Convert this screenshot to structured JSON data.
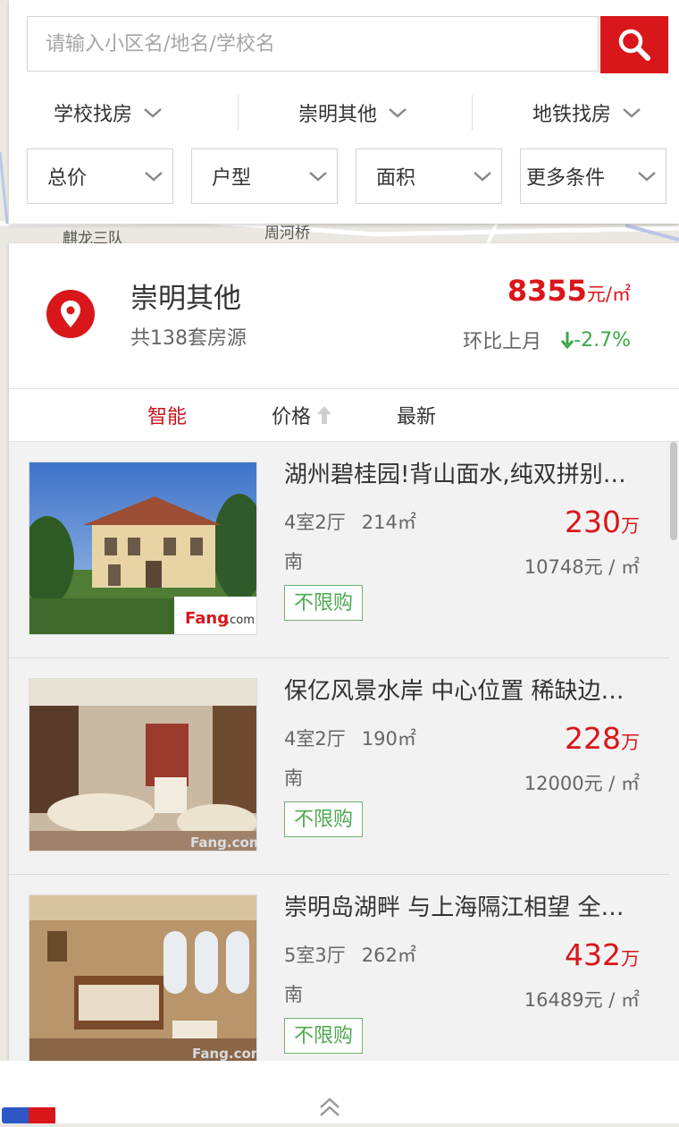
{
  "map": {
    "labels": [
      "麒龙三队",
      "周河桥"
    ]
  },
  "search": {
    "placeholder": "请输入小区名/地名/学校名"
  },
  "quick_filters": [
    {
      "label": "学校找房"
    },
    {
      "label": "崇明其他"
    },
    {
      "label": "地铁找房"
    }
  ],
  "conditions": [
    {
      "label": "总价"
    },
    {
      "label": "户型"
    },
    {
      "label": "面积"
    },
    {
      "label": "更多条件"
    }
  ],
  "area": {
    "name": "崇明其他",
    "count_text": "共138套房源",
    "price": "8355",
    "price_unit": "元/㎡",
    "change_label": "环比上月",
    "change_pct": "-2.7%"
  },
  "sort": {
    "smart": "智能",
    "price": "价格",
    "latest": "最新"
  },
  "listings": [
    {
      "title": "湖州碧桂园!背山面水,纯双拼别墅,配套齐全",
      "rooms": "4室2厅",
      "area": "214㎡",
      "orientation": "南",
      "price": "230",
      "price_unit": "万",
      "unit_price": "10748元 / ㎡",
      "tag": "不限购",
      "image": "villa-exterior-photo"
    },
    {
      "title": "保亿风景水岸 中心位置 稀缺边户 急售",
      "rooms": "4室2厅",
      "area": "190㎡",
      "orientation": "南",
      "price": "228",
      "price_unit": "万",
      "unit_price": "12000元 / ㎡",
      "tag": "不限购",
      "image": "living-room-photo"
    },
    {
      "title": "崇明岛湖畔 与上海隔江相望 全装修别墅",
      "rooms": "5室3厅",
      "area": "262㎡",
      "orientation": "南",
      "price": "432",
      "price_unit": "万",
      "unit_price": "16489元 / ㎡",
      "tag": "不限购",
      "image": "bedroom-photo"
    }
  ],
  "colors": {
    "accent": "#d9161a",
    "tag_green": "#4ea851",
    "down_green": "#3aa846"
  }
}
